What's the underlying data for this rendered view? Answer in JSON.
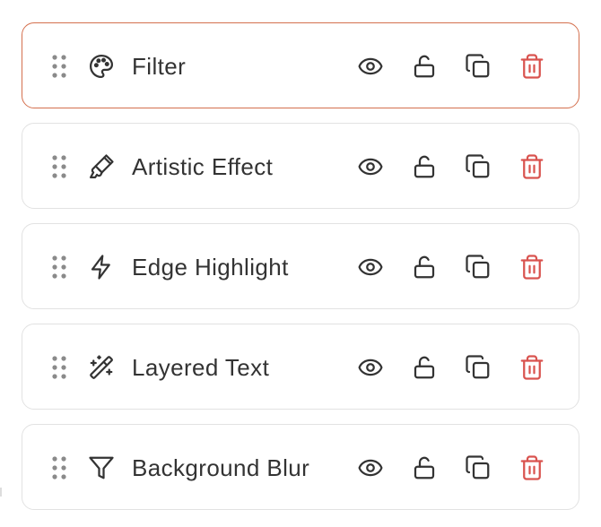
{
  "layers": [
    {
      "name": "Filter",
      "icon": "palette-icon",
      "selected": true
    },
    {
      "name": "Artistic Effect",
      "icon": "brush-icon",
      "selected": false
    },
    {
      "name": "Edge Highlight",
      "icon": "zap-icon",
      "selected": false
    },
    {
      "name": "Layered Text",
      "icon": "magic-wand-icon",
      "selected": false
    },
    {
      "name": "Background Blur",
      "icon": "funnel-icon",
      "selected": false
    }
  ],
  "actions": [
    "eye-icon",
    "unlock-icon",
    "copy-icon",
    "trash-icon"
  ],
  "colors": {
    "selected_border": "#d4704e",
    "border": "#e2e2e2",
    "text": "#333333",
    "handle": "#8a8a8a",
    "delete": "#d9534f"
  }
}
